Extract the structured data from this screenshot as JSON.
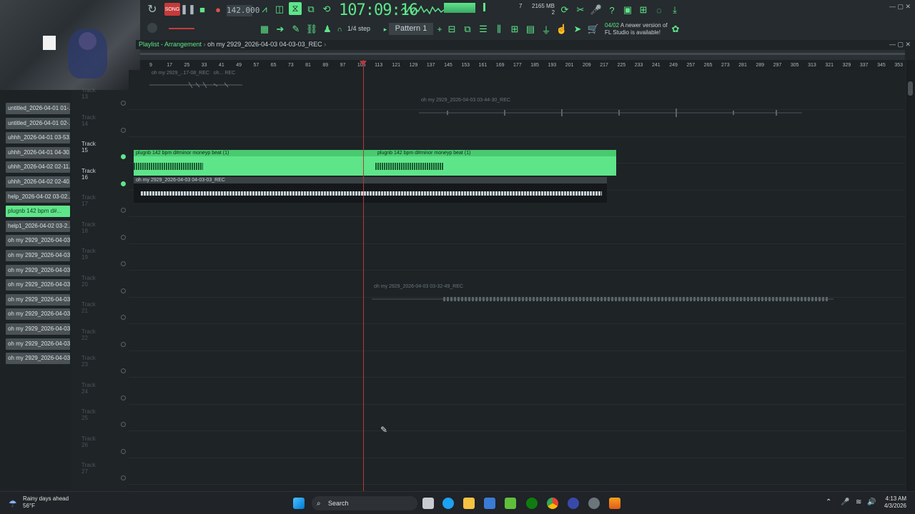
{
  "toolbar": {
    "tempo": "142.000",
    "time": "107:09:16",
    "memory_mb": "2165 MB",
    "memory_n": "2",
    "cpu_val": "7",
    "snap_label": "1/4 step",
    "pattern": "Pattern 1",
    "update_date": "04/02",
    "update_line1": "A newer version of",
    "update_line2": "FL Studio is available!"
  },
  "playlist": {
    "title": "Playlist - Arrangement",
    "breadcrumb": "oh my 2929_2026-04-03 04-03-03_REC",
    "ruler": [
      "9",
      "17",
      "25",
      "33",
      "41",
      "49",
      "57",
      "65",
      "73",
      "81",
      "89",
      "97",
      "105",
      "113",
      "121",
      "129",
      "137",
      "145",
      "153",
      "161",
      "169",
      "177",
      "185",
      "193",
      "201",
      "209",
      "217",
      "225",
      "233",
      "241",
      "249",
      "257",
      "265",
      "273",
      "281",
      "289",
      "297",
      "305",
      "313",
      "321",
      "329",
      "337",
      "345",
      "353"
    ]
  },
  "browser": {
    "items": [
      "untitled_2026-04-01 01-...",
      "untitled_2026-04-01 02-...",
      "uhhh_2026-04-01 03-53...",
      "uhhh_2026-04-01 04-30...",
      "uhhh_2026-04-02 02-11...",
      "uhhh_2026-04-02 02-40...",
      "help_2026-04-02 03-02...",
      "plugnb 142 bpm d#...",
      "help1_2026-04-02 03-2...",
      "oh my 2929_2026-04-03...",
      "oh my 2929_2026-04-03...",
      "oh my 2929_2026-04-03...",
      "oh my 2929_2026-04-03...",
      "oh my 2929_2026-04-03...",
      "oh my 2929_2026-04-03...",
      "oh my 2929_2026-04-03...",
      "oh my 2929_2026-04-03...",
      "oh my 2929_2026-04-03..."
    ]
  },
  "tracks": [
    "Track 13",
    "Track 14",
    "Track 15",
    "Track 16",
    "Track 17",
    "Track 18",
    "Track 19",
    "Track 20",
    "Track 21",
    "Track 22",
    "Track 23",
    "Track 24",
    "Track 25",
    "Track 26",
    "Track 27"
  ],
  "clips": {
    "top_ghost_1": "oh my 2929_..17-08_REC",
    "top_ghost_2": "oh... REC",
    "track14_ghost": "oh my 2929_2026-04-03 03-44-30_REC",
    "track15_a": "plugnb 142 bpm d#minor moneyp beat (1)",
    "track15_b": "plugnb 142 bpm d#minor moneyp beat (1)",
    "track16": "oh my 2929_2026-04-03 04-03-03_REC",
    "track21_ghost": "oh my 2929_2026-04-03 03-32-49_REC"
  },
  "taskbar": {
    "weather_title": "Rainy days ahead",
    "weather_temp": "56°F",
    "search": "Search",
    "time": "4:13 AM",
    "date": "4/3/2026"
  },
  "colors": {
    "accent": "#5ee58a",
    "playhead": "#b23a3a"
  }
}
